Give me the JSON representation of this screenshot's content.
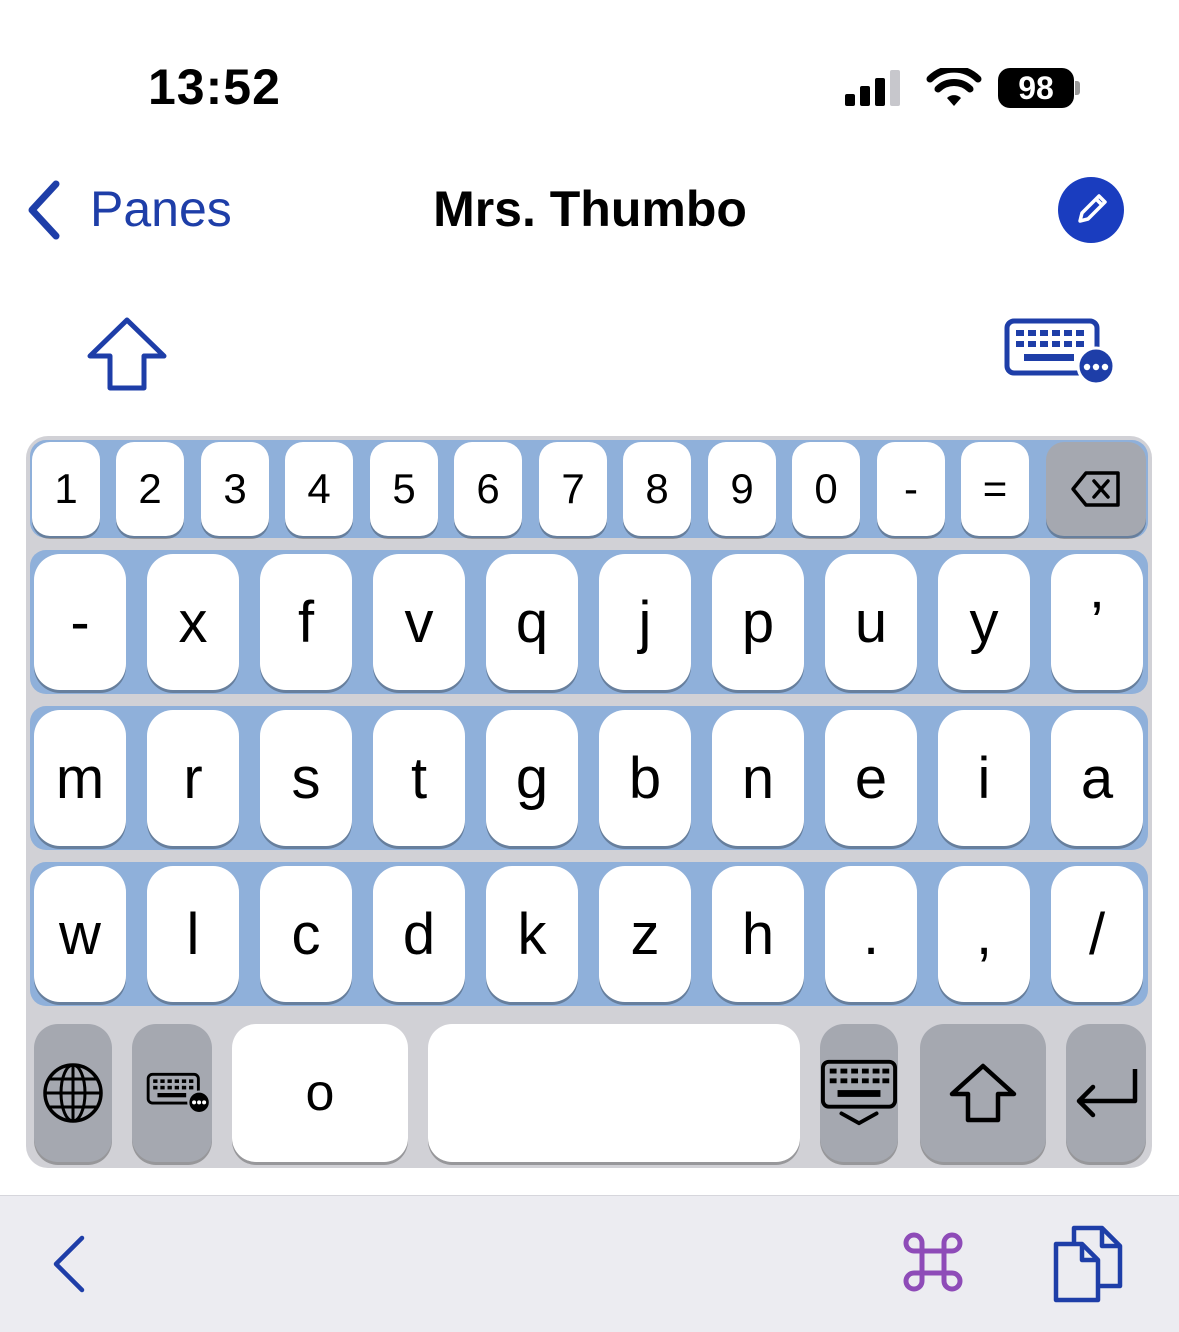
{
  "status_bar": {
    "time": "13:52",
    "battery": "98",
    "signal_icon": "cellular-signal-icon",
    "wifi_icon": "wifi-icon"
  },
  "nav": {
    "back_label": "Panes",
    "title": "Mrs. Thumbo",
    "edit_icon": "pencil-icon"
  },
  "toolbar_top": {
    "shift_icon": "shift-outline-icon",
    "keyboard_options_icon": "keyboard-ellipsis-icon"
  },
  "keyboard": {
    "number_row": [
      "1",
      "2",
      "3",
      "4",
      "5",
      "6",
      "7",
      "8",
      "9",
      "0",
      "-",
      "="
    ],
    "row2": [
      "-",
      "x",
      "f",
      "v",
      "q",
      "j",
      "p",
      "u",
      "y",
      "’"
    ],
    "row3": [
      "m",
      "r",
      "s",
      "t",
      "g",
      "b",
      "n",
      "e",
      "i",
      "a"
    ],
    "row4": [
      "w",
      "l",
      "c",
      "d",
      "k",
      "z",
      "h",
      ".",
      ",",
      "/"
    ],
    "bottom_row": {
      "o_key": "o",
      "globe_icon": "globe-icon",
      "keyboard_menu_icon": "keyboard-ellipsis-icon",
      "dismiss_icon": "keyboard-dismiss-icon",
      "shift_icon": "shift-icon",
      "return_icon": "return-icon"
    },
    "backspace_icon": "backspace-icon"
  },
  "colors": {
    "accent": "#1e3ea8",
    "row_highlight": "#8fb0da",
    "keyboard_bg": "#d1d1d6",
    "special_key": "#a5a8b0",
    "command_icon": "#8e4bb8"
  },
  "bottom_toolbar": {
    "back_icon": "chevron-left-icon",
    "command_icon": "command-icon",
    "copy_icon": "copy-documents-icon"
  }
}
